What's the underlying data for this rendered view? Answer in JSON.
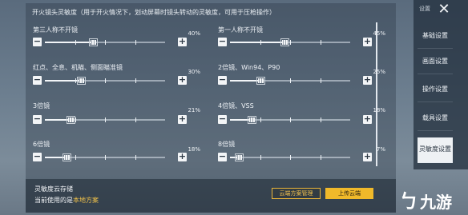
{
  "header": "开火镜头灵敏度（用于开火情况下，划动屏幕时镜头转动的灵敏度，可用于压枪操作）",
  "sliders": [
    {
      "label": "第三人称不开镜",
      "value": "40%",
      "level": 0.4
    },
    {
      "label": "第一人称不开镜",
      "value": "45%",
      "level": 0.45
    },
    {
      "label": "红点、全息、机瞄、侧面瞄准镜",
      "value": "30%",
      "level": 0.3
    },
    {
      "label": "2倍镜、Win94、P90",
      "value": "25%",
      "level": 0.25
    },
    {
      "label": "3倍镜",
      "value": "21%",
      "level": 0.21
    },
    {
      "label": "4倍镜、VSS",
      "value": "18%",
      "level": 0.18
    },
    {
      "label": "6倍镜",
      "value": "18%",
      "level": 0.18
    },
    {
      "label": "8倍镜",
      "value": "7%",
      "level": 0.07
    }
  ],
  "controls": {
    "minus": "−",
    "plus": "+"
  },
  "cloud": {
    "title": "灵敏度云存储",
    "current_prefix": "当前使用的是",
    "current_plan": "本地方案",
    "manage_button": "云端方案管理",
    "upload_button": "上传云端"
  },
  "sidebar": {
    "top_label": "设置",
    "close_icon": "close-icon",
    "tabs": [
      {
        "label": "基础设置"
      },
      {
        "label": "画面设置"
      },
      {
        "label": "操作设置"
      },
      {
        "label": "载具设置"
      },
      {
        "label": "灵敏度设置",
        "active": true
      }
    ]
  },
  "logo": {
    "text": "九游",
    "icon": "jiuyou-logo-icon"
  },
  "colors": {
    "accent": "#f0b92a",
    "highlight": "#f1c24a"
  }
}
